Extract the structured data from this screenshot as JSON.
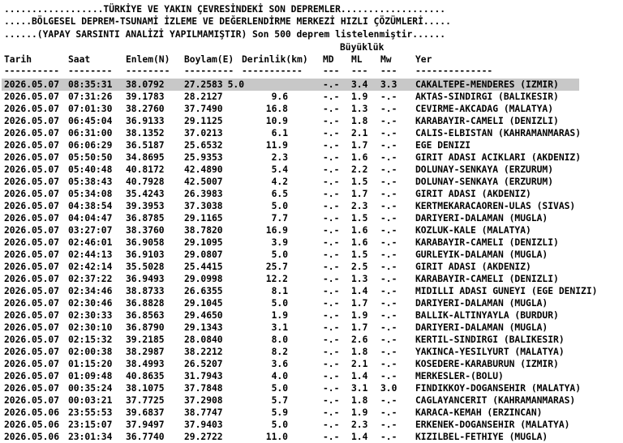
{
  "header": {
    "line1": "..................TÜRKİYE VE YAKIN ÇEVRESİNDEKİ SON DEPREMLER...................",
    "line2": ".....BÖLGESEL DEPREM-TSUNAMİ İZLEME VE DEĞERLENDİRME MERKEZİ HIZLI ÇÖZÜMLERİ.....",
    "line3": "......(YAPAY SARSINTI ANALİZİ YAPILMAMIŞTIR) Son 500 deprem listelenmiştir......",
    "magnitude_label": "Büyüklük"
  },
  "columns": {
    "tarih": "Tarih",
    "saat": "Saat",
    "enlem": "Enlem(N)",
    "boylam": "Boylam(E)",
    "derinlik": "Derinlik(km)",
    "md": "MD",
    "ml": "ML",
    "mw": "Mw",
    "yer": "Yer"
  },
  "dashes": {
    "tarih": "----------",
    "saat": "--------",
    "enlem": "--------",
    "boylam": "---------",
    "derinlik": "-----------",
    "md": "---",
    "ml": "---",
    "mw": "---",
    "yer": "--------------"
  },
  "selected_row_index": 0,
  "rows": [
    {
      "date": "2026.05.07",
      "time": "08:35:31",
      "lat": "38.0792",
      "lon": "27.2583",
      "depth": "5.0",
      "md": "-.-",
      "ml": "3.4",
      "mw": "3.3",
      "place": "CAKALTEPE-MENDERES (IZMIR)"
    },
    {
      "date": "2026.05.07",
      "time": "07:31:26",
      "lat": "39.1783",
      "lon": "28.2127",
      "depth": "9.6",
      "md": "-.-",
      "ml": "1.9",
      "mw": "-.-",
      "place": "AKTAS-SINDIRGI (BALIKESIR)"
    },
    {
      "date": "2026.05.07",
      "time": "07:01:30",
      "lat": "38.2760",
      "lon": "37.7490",
      "depth": "16.8",
      "md": "-.-",
      "ml": "1.3",
      "mw": "-.-",
      "place": "CEVIRME-AKCADAG (MALATYA)"
    },
    {
      "date": "2026.05.07",
      "time": "06:45:04",
      "lat": "36.9133",
      "lon": "29.1125",
      "depth": "10.9",
      "md": "-.-",
      "ml": "1.8",
      "mw": "-.-",
      "place": "KARABAYIR-CAMELI (DENIZLI)"
    },
    {
      "date": "2026.05.07",
      "time": "06:31:00",
      "lat": "38.1352",
      "lon": "37.0213",
      "depth": "6.1",
      "md": "-.-",
      "ml": "2.1",
      "mw": "-.-",
      "place": "CALIS-ELBISTAN (KAHRAMANMARAS)"
    },
    {
      "date": "2026.05.07",
      "time": "06:06:29",
      "lat": "36.5187",
      "lon": "25.6532",
      "depth": "11.9",
      "md": "-.-",
      "ml": "1.7",
      "mw": "-.-",
      "place": "EGE DENIZI"
    },
    {
      "date": "2026.05.07",
      "time": "05:50:50",
      "lat": "34.8695",
      "lon": "25.9353",
      "depth": "2.3",
      "md": "-.-",
      "ml": "1.6",
      "mw": "-.-",
      "place": "GIRIT ADASI ACIKLARI (AKDENIZ)"
    },
    {
      "date": "2026.05.07",
      "time": "05:40:48",
      "lat": "40.8172",
      "lon": "42.4890",
      "depth": "5.4",
      "md": "-.-",
      "ml": "2.2",
      "mw": "-.-",
      "place": "DOLUNAY-SENKAYA (ERZURUM)"
    },
    {
      "date": "2026.05.07",
      "time": "05:38:43",
      "lat": "40.7928",
      "lon": "42.5007",
      "depth": "4.2",
      "md": "-.-",
      "ml": "1.5",
      "mw": "-.-",
      "place": "DOLUNAY-SENKAYA (ERZURUM)"
    },
    {
      "date": "2026.05.07",
      "time": "05:34:08",
      "lat": "35.4243",
      "lon": "26.3983",
      "depth": "6.5",
      "md": "-.-",
      "ml": "1.7",
      "mw": "-.-",
      "place": "GIRIT ADASI (AKDENIZ)"
    },
    {
      "date": "2026.05.07",
      "time": "04:38:54",
      "lat": "39.3953",
      "lon": "37.3038",
      "depth": "5.0",
      "md": "-.-",
      "ml": "2.3",
      "mw": "-.-",
      "place": "KERTMEKARACAOREN-ULAS (SIVAS)"
    },
    {
      "date": "2026.05.07",
      "time": "04:04:47",
      "lat": "36.8785",
      "lon": "29.1165",
      "depth": "7.7",
      "md": "-.-",
      "ml": "1.5",
      "mw": "-.-",
      "place": "DARIYERI-DALAMAN (MUGLA)"
    },
    {
      "date": "2026.05.07",
      "time": "03:27:07",
      "lat": "38.3760",
      "lon": "38.7820",
      "depth": "16.9",
      "md": "-.-",
      "ml": "1.6",
      "mw": "-.-",
      "place": "KOZLUK-KALE (MALATYA)"
    },
    {
      "date": "2026.05.07",
      "time": "02:46:01",
      "lat": "36.9058",
      "lon": "29.1095",
      "depth": "3.9",
      "md": "-.-",
      "ml": "1.6",
      "mw": "-.-",
      "place": "KARABAYIR-CAMELI (DENIZLI)"
    },
    {
      "date": "2026.05.07",
      "time": "02:44:13",
      "lat": "36.9103",
      "lon": "29.0807",
      "depth": "5.0",
      "md": "-.-",
      "ml": "1.5",
      "mw": "-.-",
      "place": "GURLEYIK-DALAMAN (MUGLA)"
    },
    {
      "date": "2026.05.07",
      "time": "02:42:14",
      "lat": "35.5028",
      "lon": "25.4415",
      "depth": "25.7",
      "md": "-.-",
      "ml": "2.5",
      "mw": "-.-",
      "place": "GIRIT ADASI (AKDENIZ)"
    },
    {
      "date": "2026.05.07",
      "time": "02:37:22",
      "lat": "36.9493",
      "lon": "29.0998",
      "depth": "12.2",
      "md": "-.-",
      "ml": "1.3",
      "mw": "-.-",
      "place": "KARABAYIR-CAMELI (DENIZLI)"
    },
    {
      "date": "2026.05.07",
      "time": "02:34:46",
      "lat": "38.8733",
      "lon": "26.6355",
      "depth": "8.1",
      "md": "-.-",
      "ml": "1.4",
      "mw": "-.-",
      "place": "MIDILLI ADASI GUNEYI (EGE DENIZI)"
    },
    {
      "date": "2026.05.07",
      "time": "02:30:46",
      "lat": "36.8828",
      "lon": "29.1045",
      "depth": "5.0",
      "md": "-.-",
      "ml": "1.7",
      "mw": "-.-",
      "place": "DARIYERI-DALAMAN (MUGLA)"
    },
    {
      "date": "2026.05.07",
      "time": "02:30:33",
      "lat": "36.8563",
      "lon": "29.4650",
      "depth": "1.9",
      "md": "-.-",
      "ml": "1.9",
      "mw": "-.-",
      "place": "BALLIK-ALTINYAYLA (BURDUR)"
    },
    {
      "date": "2026.05.07",
      "time": "02:30:10",
      "lat": "36.8790",
      "lon": "29.1343",
      "depth": "3.1",
      "md": "-.-",
      "ml": "1.7",
      "mw": "-.-",
      "place": "DARIYERI-DALAMAN (MUGLA)"
    },
    {
      "date": "2026.05.07",
      "time": "02:15:32",
      "lat": "39.2185",
      "lon": "28.0840",
      "depth": "8.0",
      "md": "-.-",
      "ml": "2.6",
      "mw": "-.-",
      "place": "KERTIL-SINDIRGI (BALIKESIR)"
    },
    {
      "date": "2026.05.07",
      "time": "02:00:38",
      "lat": "38.2987",
      "lon": "38.2212",
      "depth": "8.2",
      "md": "-.-",
      "ml": "1.8",
      "mw": "-.-",
      "place": "YAKINCA-YESILYURT (MALATYA)"
    },
    {
      "date": "2026.05.07",
      "time": "01:15:20",
      "lat": "38.4993",
      "lon": "26.5207",
      "depth": "3.6",
      "md": "-.-",
      "ml": "2.1",
      "mw": "-.-",
      "place": "KOSEDERE-KARABURUN (IZMIR)"
    },
    {
      "date": "2026.05.07",
      "time": "01:09:48",
      "lat": "40.8635",
      "lon": "31.7943",
      "depth": "4.0",
      "md": "-.-",
      "ml": "1.4",
      "mw": "-.-",
      "place": "MERKESLER-(BOLU)"
    },
    {
      "date": "2026.05.07",
      "time": "00:35:24",
      "lat": "38.1075",
      "lon": "37.7848",
      "depth": "5.0",
      "md": "-.-",
      "ml": "3.1",
      "mw": "3.0",
      "place": "FINDIKKOY-DOGANSEHIR (MALATYA)"
    },
    {
      "date": "2026.05.07",
      "time": "00:03:21",
      "lat": "37.7725",
      "lon": "37.2908",
      "depth": "5.7",
      "md": "-.-",
      "ml": "1.8",
      "mw": "-.-",
      "place": "CAGLAYANCERIT (KAHRAMANMARAS)"
    },
    {
      "date": "2026.05.06",
      "time": "23:55:53",
      "lat": "39.6837",
      "lon": "38.7747",
      "depth": "5.9",
      "md": "-.-",
      "ml": "1.9",
      "mw": "-.-",
      "place": "KARACA-KEMAH (ERZINCAN)"
    },
    {
      "date": "2026.05.06",
      "time": "23:15:07",
      "lat": "37.9497",
      "lon": "37.9403",
      "depth": "5.0",
      "md": "-.-",
      "ml": "2.3",
      "mw": "-.-",
      "place": "ERKENEK-DOGANSEHIR (MALATYA)"
    },
    {
      "date": "2026.05.06",
      "time": "23:01:34",
      "lat": "36.7740",
      "lon": "29.2722",
      "depth": "11.0",
      "md": "-.-",
      "ml": "1.4",
      "mw": "-.-",
      "place": "KIZILBEL-FETHIYE (MUGLA)"
    }
  ]
}
